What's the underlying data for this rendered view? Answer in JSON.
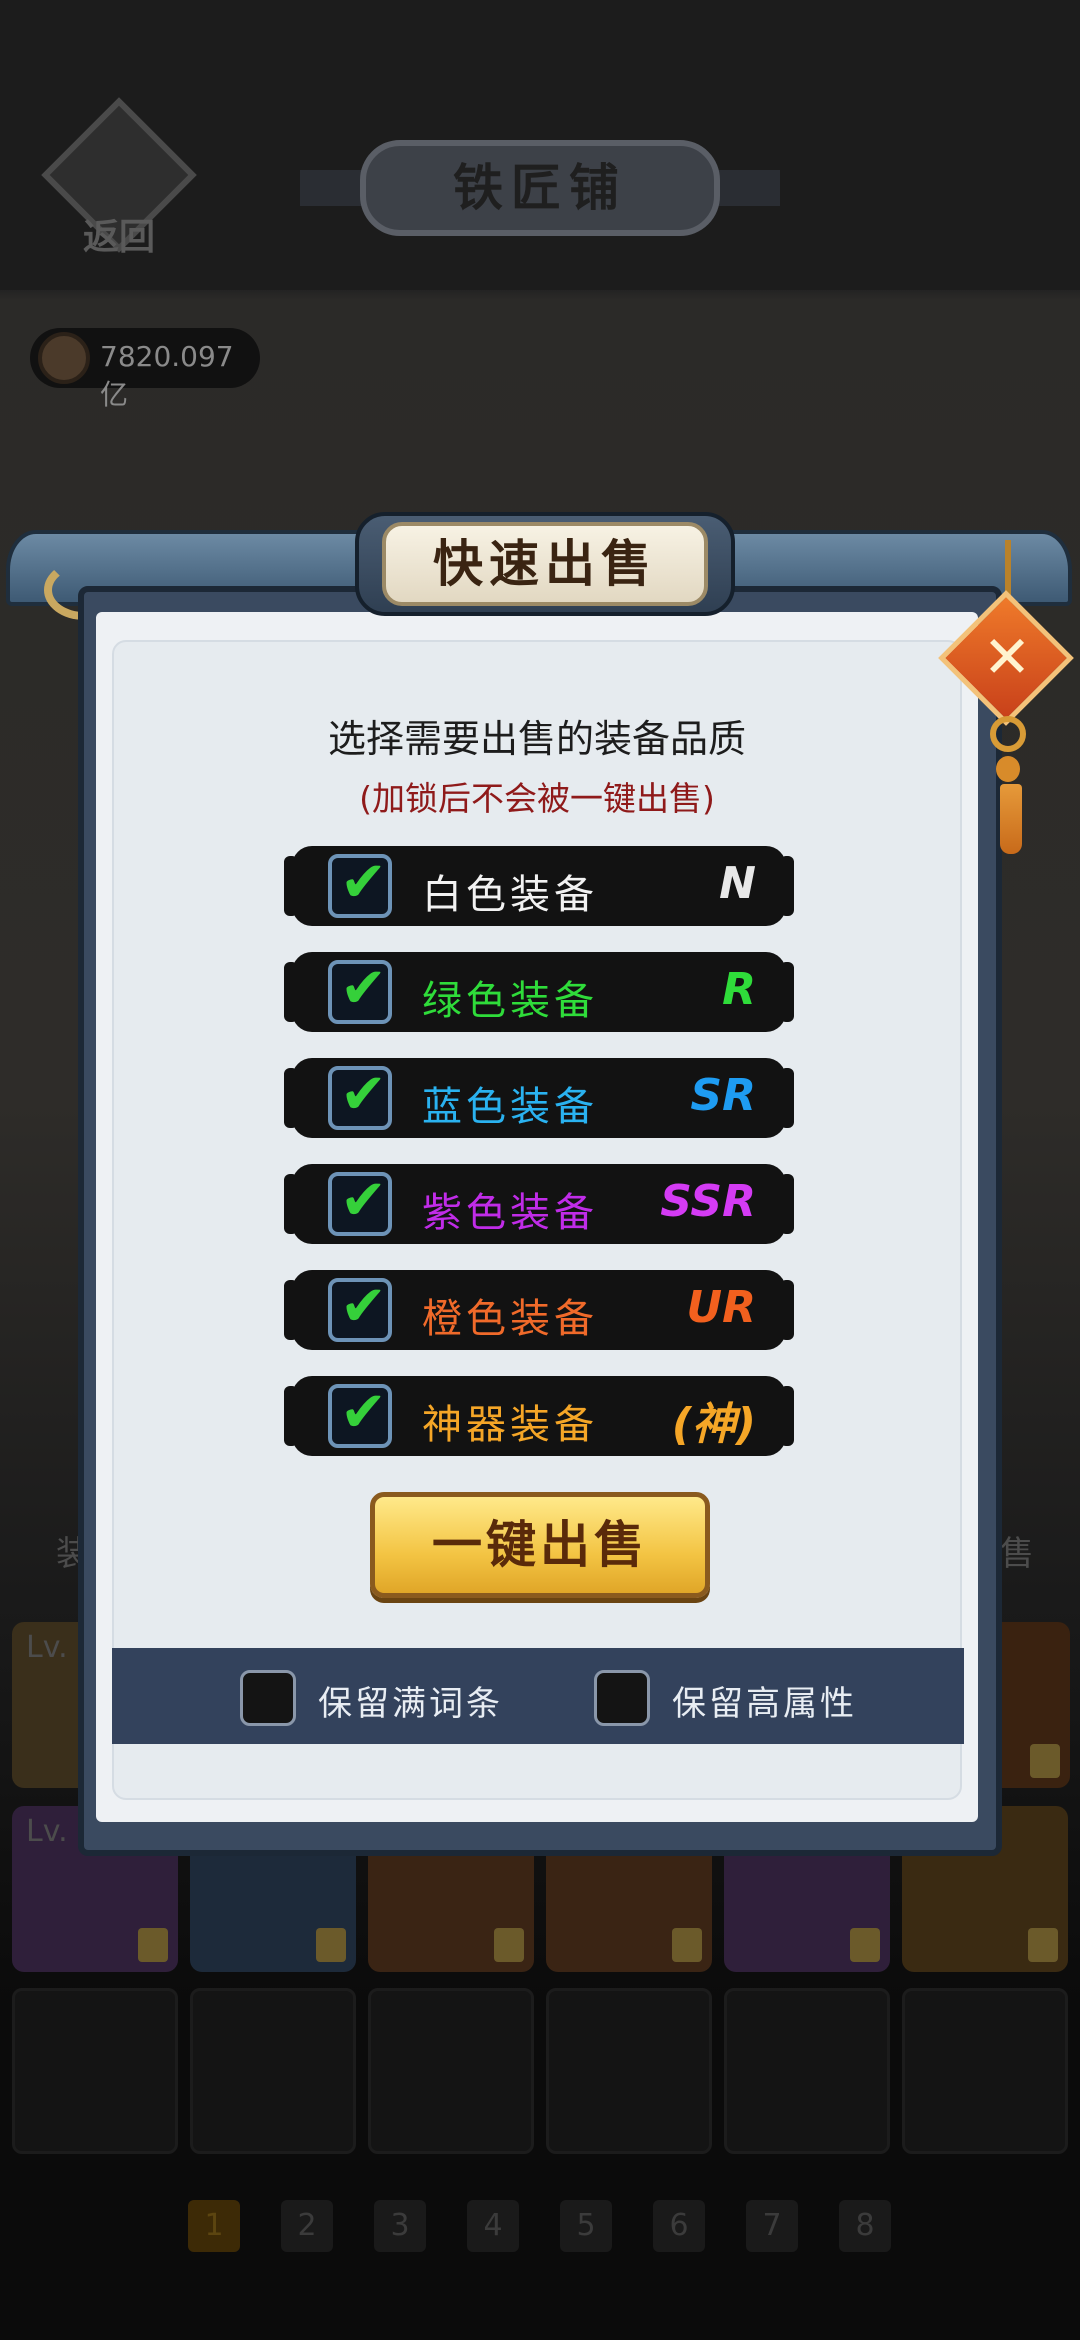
{
  "background": {
    "back_label": "返回",
    "page_title": "铁匠铺",
    "coin_value": "7820.097亿",
    "side_left": "装",
    "side_right": "售",
    "item_level_label": "Lv.",
    "pages": [
      "1",
      "2",
      "3",
      "4",
      "5",
      "6",
      "7",
      "8"
    ],
    "active_page": "1"
  },
  "dialog": {
    "title": "快速出售",
    "close_label": "✕",
    "prompt": "选择需要出售的装备品质",
    "subprompt": "(加锁后不会被一键出售)",
    "qualities": [
      {
        "label": "白色装备",
        "tag": "N",
        "color": "#f2f2f2",
        "tag_color": "#e8e8e8",
        "checked": true
      },
      {
        "label": "绿色装备",
        "tag": "R",
        "color": "#2fdc3a",
        "tag_color": "#2fdc3a",
        "checked": true
      },
      {
        "label": "蓝色装备",
        "tag": "SR",
        "color": "#2ab2f0",
        "tag_color": "#1e9cf2",
        "checked": true
      },
      {
        "label": "紫色装备",
        "tag": "SSR",
        "color": "#c02ce8",
        "tag_color": "#d43bf4",
        "checked": true
      },
      {
        "label": "橙色装备",
        "tag": "UR",
        "color": "#f06a2a",
        "tag_color": "#f2601e",
        "checked": true
      },
      {
        "label": "神器装备",
        "tag": "(神)",
        "color": "#f5a627",
        "tag_color": "#f5a627",
        "checked": true
      }
    ],
    "check_glyph": "✔",
    "sell_button": "一键出售",
    "options": [
      {
        "label": "保留满词条",
        "checked": false
      },
      {
        "label": "保留高属性",
        "checked": false
      }
    ]
  }
}
